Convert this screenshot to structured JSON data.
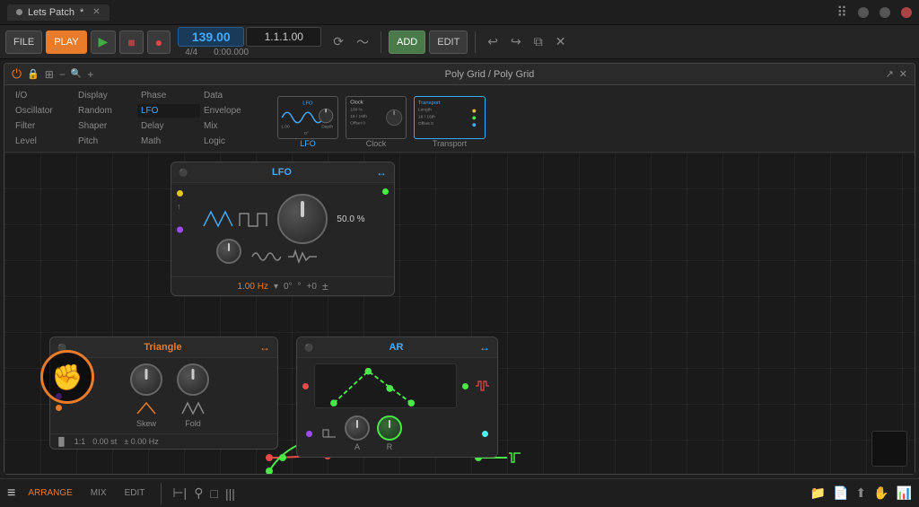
{
  "titlebar": {
    "tab_label": "Lets Patch",
    "tab_modified": true,
    "dots_label": "⠿"
  },
  "toolbar": {
    "file_label": "FILE",
    "play_label": "PLAY",
    "play_icon": "▶",
    "stop_icon": "■",
    "record_icon": "●",
    "tempo": "139.00",
    "meter": "4/4",
    "position": "1.1.1.00",
    "time": "0:00.000",
    "add_label": "ADD",
    "edit_label": "EDIT",
    "undo_icon": "↩",
    "redo_icon": "↪",
    "copy_icon": "⧉",
    "delete_icon": "✕"
  },
  "plugin_window": {
    "title": "Poly Grid / Poly Grid",
    "power": "⏻",
    "lock": "🔒",
    "grid": "⊞",
    "minus": "−",
    "plus": "+"
  },
  "nav": {
    "col1": [
      "I/O",
      "Oscillator",
      "Filter",
      "Level"
    ],
    "col2": [
      "Display",
      "Random",
      "Shaper",
      "Pitch"
    ],
    "col3": [
      "Phase",
      "LFO",
      "Delay",
      "Math"
    ],
    "col4": [
      "Data",
      "Envelope",
      "Mix",
      "Logic"
    ]
  },
  "modules": {
    "lfo_thumb": {
      "label": "LFO",
      "selected": true
    },
    "clock_thumb": {
      "label": "Clock",
      "title": "Clock",
      "row1": "100 %",
      "row2": "16 / 16th",
      "row3": "Offset  0"
    },
    "transport_thumb": {
      "label": "Transport",
      "title": "Transport",
      "row1": "Length",
      "row2": "16 / 16th",
      "row3": "Offset  0"
    }
  },
  "lfo_module": {
    "title": "LFO",
    "percent": "50.0 %",
    "hz": "1.00 Hz",
    "phase": "0°",
    "offset": "+0",
    "arrow_icon": "↔"
  },
  "triangle_module": {
    "title": "Triangle",
    "skew_label": "Skew",
    "fold_label": "Fold",
    "ratio": "1:1",
    "semitones": "0.00 st",
    "hz_offset": "± 0.00 Hz"
  },
  "ar_module": {
    "title": "AR",
    "a_label": "A",
    "r_label": "R",
    "arrow_icon": "↔"
  },
  "statusbar": {
    "arrange_label": "ARRANGE",
    "mix_label": "MIX",
    "edit_label": "EDIT",
    "icons": [
      "⊢|",
      "⚲",
      "□",
      "|||"
    ]
  },
  "colors": {
    "accent_orange": "#e87c2a",
    "accent_blue": "#4af",
    "accent_green": "#4ae848",
    "accent_purple": "#a04aff",
    "accent_yellow": "#e8c420",
    "accent_red": "#e84a4a",
    "accent_teal": "#20c8a0"
  }
}
